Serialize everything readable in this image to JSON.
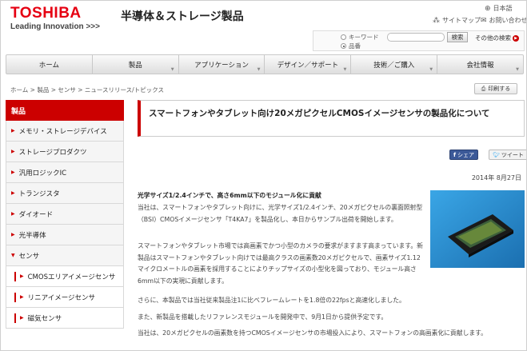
{
  "header": {
    "logo_text": "TOSHIBA",
    "logo_tagline": "Leading Innovation >>>",
    "site_title": "半導体＆ストレージ製品",
    "language_link": "日本語",
    "sitemap_link": "サイトマップ",
    "contact_link": "お問い合わせ"
  },
  "search": {
    "radio_keyword": "キーワード",
    "radio_part_number": "品番",
    "placeholder": "",
    "button_label": "検索",
    "other_search": "その他の検索"
  },
  "nav": {
    "items": [
      {
        "label": "ホーム"
      },
      {
        "label": "製品"
      },
      {
        "label": "アプリケーション"
      },
      {
        "label": "デザイン／サポート"
      },
      {
        "label": "技術／ご購入"
      },
      {
        "label": "会社情報"
      }
    ]
  },
  "breadcrumb": "ホーム > 製品 > センサ > ニュースリリース/トピックス",
  "print_label": "印刷する",
  "sidebar": {
    "header": "製品",
    "items": [
      {
        "label": "メモリ・ストレージデバイス"
      },
      {
        "label": "ストレージプロダクツ"
      },
      {
        "label": "汎用ロジックIC"
      },
      {
        "label": "トランジスタ"
      },
      {
        "label": "ダイオード"
      },
      {
        "label": "光半導体"
      },
      {
        "label": "センサ"
      }
    ],
    "sub_items": [
      {
        "label": "CMOSエリアイメージセンサ"
      },
      {
        "label": "リニアイメージセンサ"
      },
      {
        "label": "磁気センサ"
      }
    ]
  },
  "article": {
    "title": "スマートフォンやタブレット向け20メガピクセルCMOSイメージセンサの製品化について",
    "share_facebook": "シェア",
    "share_twitter": "ツイート",
    "date": "2014年 8月27日",
    "lead_bold": "光学サイズ1/2.4インチで、高さ6mm以下のモジュール化に貢献",
    "p1": "当社は、スマートフォンやタブレット向けに、光学サイズ1/2.4インチ、20メガピクセルの裏面照射型（BSI）CMOSイメージセンサ「T4KA7」を製品化し、本日からサンプル出荷を開始します。",
    "p2": "スマートフォンやタブレット市場では高画素でかつ小型のカメラの要求がますます高まっています。新製品はスマートフォンやタブレット向けでは最高クラスの画素数20メガピクセルで、画素サイズ1.12マイクロメートルの画素を採用することによりチップサイズの小型化を図っており、モジュール高さ6mm以下の実現に貢献します。",
    "p3": "さらに、本製品では当社従来製品注1に比べフレームレートを1.8倍の22fpsと高速化しました。",
    "p4": "また、新製品を搭載したリファレンスモジュールを開発中で、9月1日から提供予定です。",
    "p5": "当社は、20メガピクセルの画素数を持つCMOSイメージセンサの市場投入により、スマートフォンの高画素化に貢献します。"
  },
  "colors": {
    "brand_red": "#e60012",
    "accent_red": "#cc0000",
    "image_bg": "#2a8fd0"
  }
}
